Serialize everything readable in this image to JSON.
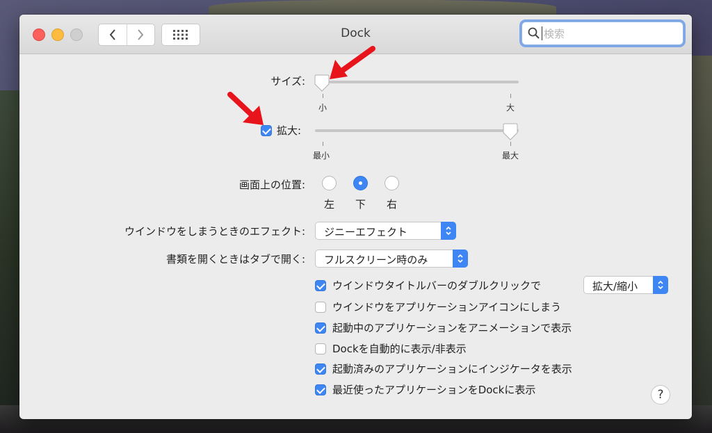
{
  "window": {
    "title": "Dock"
  },
  "search": {
    "placeholder": "検索"
  },
  "size": {
    "label": "サイズ:",
    "min_label": "小",
    "max_label": "大",
    "value": 0.0
  },
  "magnification": {
    "label": "拡大:",
    "checked": true,
    "min_label": "最小",
    "max_label": "最大",
    "value": 1.0
  },
  "position": {
    "label": "画面上の位置:",
    "options": [
      {
        "label": "左",
        "selected": false
      },
      {
        "label": "下",
        "selected": true
      },
      {
        "label": "右",
        "selected": false
      }
    ]
  },
  "minimize_effect": {
    "label": "ウインドウをしまうときのエフェクト:",
    "value": "ジニーエフェクト"
  },
  "open_tabs": {
    "label": "書類を開くときはタブで開く:",
    "value": "フルスクリーン時のみ"
  },
  "checkboxes": [
    {
      "label": "ウインドウタイトルバーのダブルクリックで",
      "checked": true,
      "popup": "拡大/縮小"
    },
    {
      "label": "ウインドウをアプリケーションアイコンにしまう",
      "checked": false
    },
    {
      "label": "起動中のアプリケーションをアニメーションで表示",
      "checked": true
    },
    {
      "label": "Dockを自動的に表示/非表示",
      "checked": false
    },
    {
      "label": "起動済みのアプリケーションにインジケータを表示",
      "checked": true
    },
    {
      "label": "最近使ったアプリケーションをDockに表示",
      "checked": true
    }
  ],
  "help": {
    "label": "?"
  },
  "colors": {
    "accent": "#3d86f4",
    "annotation_arrow": "#e8141c"
  }
}
